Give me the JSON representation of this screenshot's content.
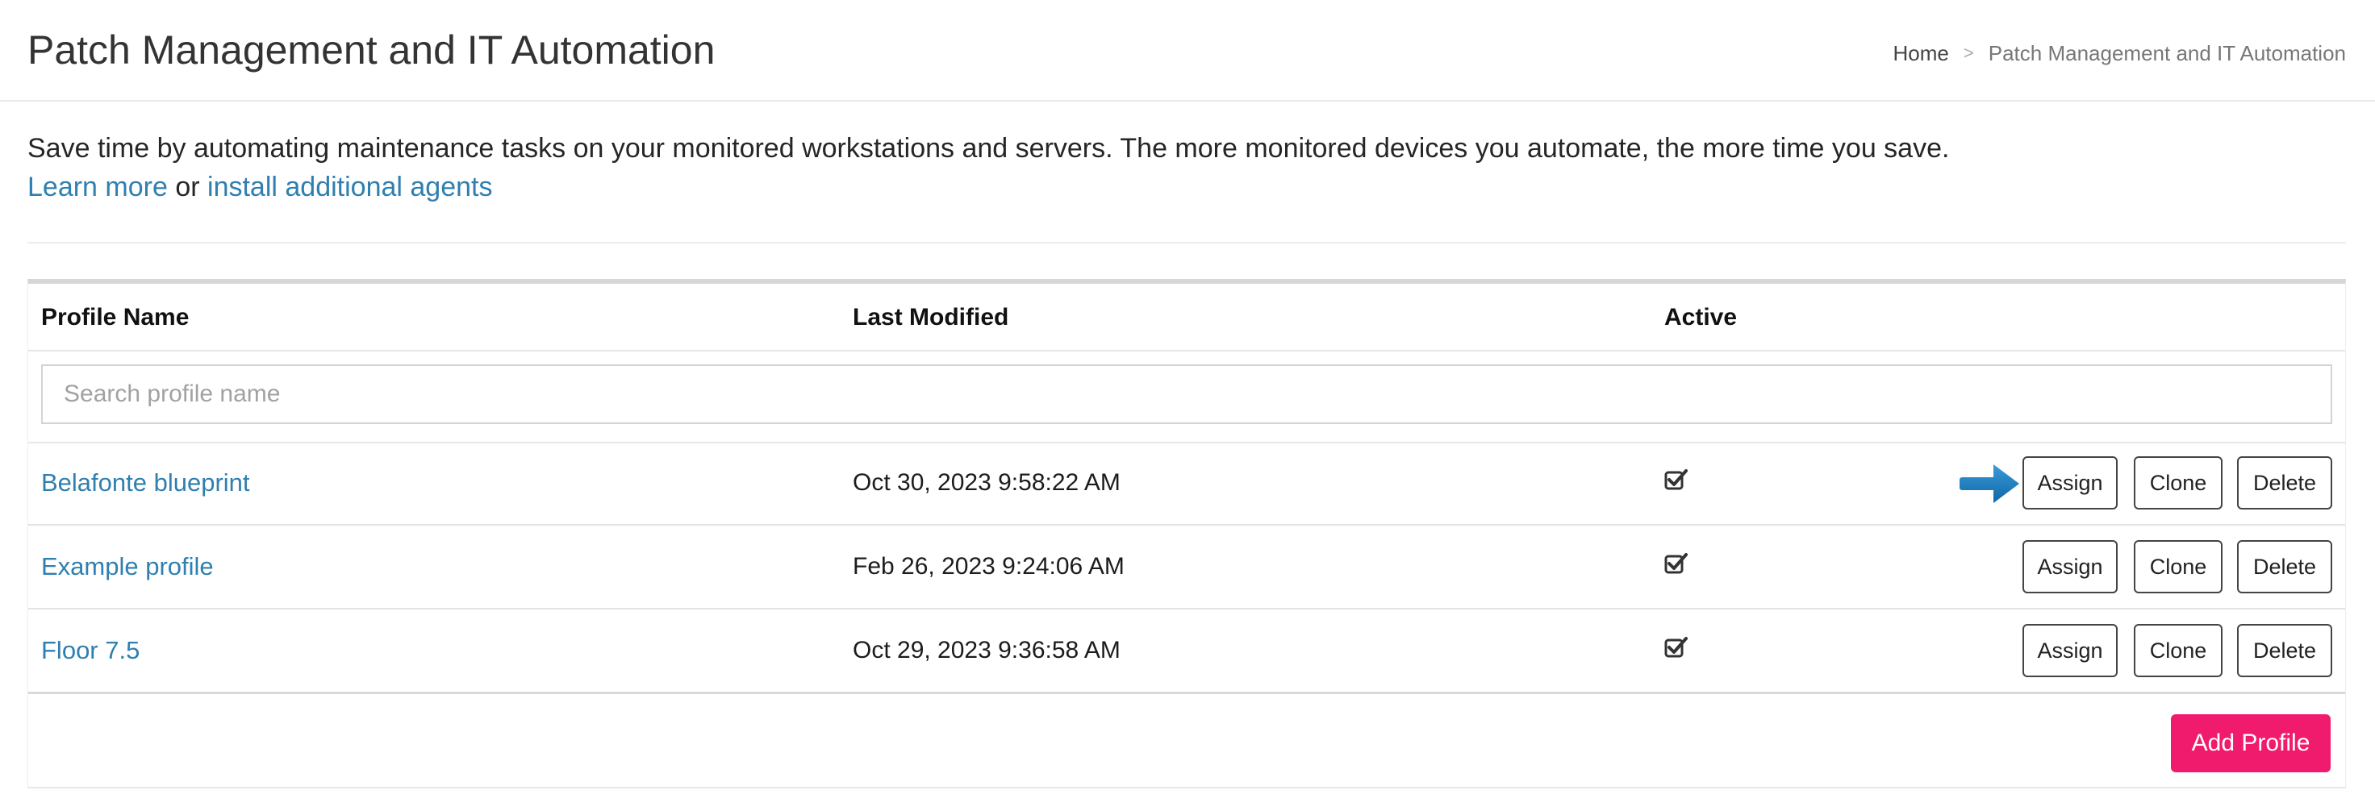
{
  "header": {
    "title": "Patch Management and IT Automation",
    "breadcrumb": {
      "home": "Home",
      "separator": ">",
      "current": "Patch Management and IT Automation"
    }
  },
  "intro": {
    "text": "Save time by automating maintenance tasks on your monitored workstations and servers. The more monitored devices you automate, the more time you save.",
    "learn_more": "Learn more",
    "or": "or",
    "install_agents": "install additional agents"
  },
  "table": {
    "columns": [
      "Profile Name",
      "Last Modified",
      "Active"
    ],
    "search_placeholder": "Search profile name",
    "rows": [
      {
        "name": "Belafonte blueprint",
        "modified": "Oct 30, 2023 9:58:22 AM",
        "active": true
      },
      {
        "name": "Example profile",
        "modified": "Feb 26, 2023 9:24:06 AM",
        "active": true
      },
      {
        "name": "Floor 7.5",
        "modified": "Oct 29, 2023 9:36:58 AM",
        "active": true
      }
    ],
    "actions": {
      "assign": "Assign",
      "clone": "Clone",
      "delete": "Delete"
    }
  },
  "add_profile_label": "Add Profile",
  "colors": {
    "link": "#2f7fb0",
    "accent": "#f01b6c",
    "arrow": "#1a7bbd"
  }
}
